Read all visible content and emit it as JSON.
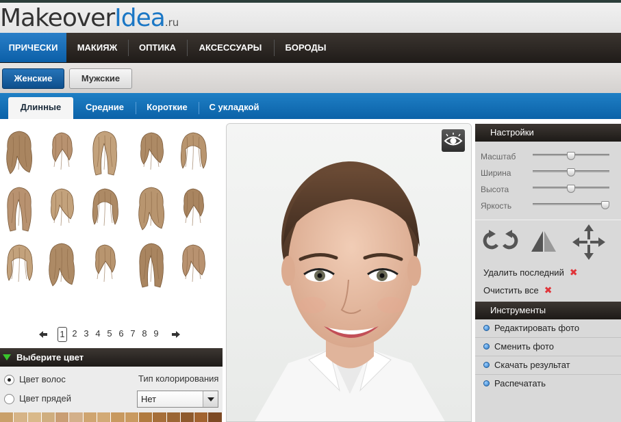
{
  "logo": {
    "part1": "Makeover",
    "part2": "Idea",
    "suffix": ".ru"
  },
  "main_menu": [
    {
      "label": "ПРИЧЕСКИ",
      "active": true
    },
    {
      "label": "МАКИЯЖ",
      "active": false
    },
    {
      "label": "ОПТИКА",
      "active": false
    },
    {
      "label": "АКСЕССУАРЫ",
      "active": false
    },
    {
      "label": "БОРОДЫ",
      "active": false
    }
  ],
  "gender": {
    "female": "Женские",
    "male": "Мужские",
    "selected": "female"
  },
  "length_tabs": [
    {
      "label": "Длинные",
      "active": true
    },
    {
      "label": "Средние",
      "active": false
    },
    {
      "label": "Короткие",
      "active": false
    },
    {
      "label": "С укладкой",
      "active": false
    }
  ],
  "hairstyles": {
    "rows": 3,
    "cols": 5,
    "items": [
      "hairstyle-1",
      "hairstyle-2",
      "hairstyle-3",
      "hairstyle-4",
      "hairstyle-5",
      "hairstyle-6",
      "hairstyle-7",
      "hairstyle-8",
      "hairstyle-9",
      "hairstyle-10",
      "hairstyle-11",
      "hairstyle-12",
      "hairstyle-13",
      "hairstyle-14",
      "hairstyle-15"
    ]
  },
  "pager": {
    "pages": [
      "1",
      "2",
      "3",
      "4",
      "5",
      "6",
      "7",
      "8",
      "9"
    ],
    "current": "1"
  },
  "color": {
    "title": "Выберите цвет",
    "hair_color_label": "Цвет волос",
    "strands_label": "Цвет прядей",
    "coloring_type_label": "Тип колорирования",
    "coloring_type_value": "Нет",
    "swatches": [
      "#c9a06a",
      "#d6b487",
      "#d9b98a",
      "#cfae7f",
      "#c99e74",
      "#d3b08a",
      "#cfa570",
      "#d2aa76",
      "#c8995f",
      "#c99a60",
      "#b07a3f",
      "#a66f3a",
      "#9b6634",
      "#8e5a2d",
      "#a1632f",
      "#7d4a24"
    ]
  },
  "photo": {
    "eye_icon": "eye-icon"
  },
  "settings": {
    "title": "Настройки",
    "sliders": [
      {
        "label": "Масштаб",
        "value": 0.5
      },
      {
        "label": "Ширина",
        "value": 0.5
      },
      {
        "label": "Высота",
        "value": 0.5
      },
      {
        "label": "Яркость",
        "value": 1.0
      }
    ],
    "tools": [
      "rotate-left-icon",
      "rotate-right-icon",
      "flip-icon",
      "move-icon"
    ],
    "delete_last": "Удалить последний",
    "clear_all": "Очистить все"
  },
  "instruments": {
    "title": "Инструменты",
    "items": [
      "Редактировать фото",
      "Сменить фото",
      "Скачать результат",
      "Распечатать"
    ]
  }
}
